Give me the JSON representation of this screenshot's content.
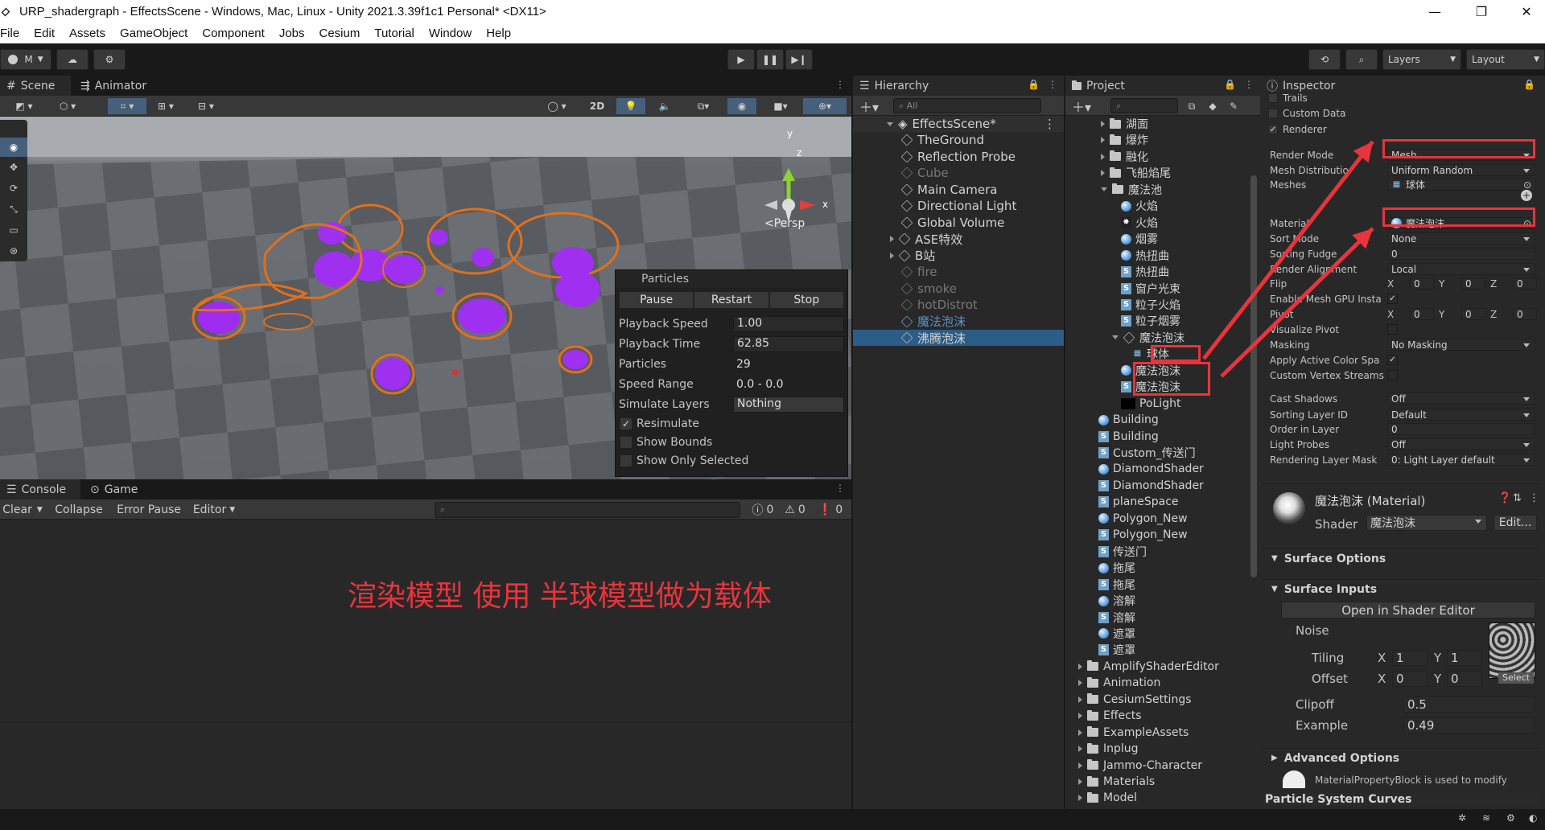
{
  "window": {
    "title": "URP_shadergraph - EffectsScene - Windows, Mac, Linux - Unity 2021.3.39f1c1 Personal* <DX11>"
  },
  "menu": [
    "File",
    "Edit",
    "Assets",
    "GameObject",
    "Component",
    "Jobs",
    "Cesium",
    "Tutorial",
    "Window",
    "Help"
  ],
  "toolbar": {
    "account": "M",
    "layers": "Layers",
    "layout": "Layout"
  },
  "scene": {
    "tabs": [
      "Scene",
      "Animator"
    ],
    "toolbar_2d": "2D",
    "persp_label": "<Persp",
    "gizmo_y": "y",
    "gizmo_x": "x",
    "gizmo_z": "z"
  },
  "particles": {
    "title": "Particles",
    "buttons": [
      "Pause",
      "Restart",
      "Stop"
    ],
    "rows": [
      {
        "label": "Playback Speed",
        "value": "1.00"
      },
      {
        "label": "Playback Time",
        "value": "62.85"
      },
      {
        "label": "Particles",
        "value": "29"
      },
      {
        "label": "Speed Range",
        "value": "0.0 - 0.0"
      },
      {
        "label": "Simulate Layers",
        "value": "Nothing"
      }
    ],
    "checks": [
      {
        "label": "Resimulate",
        "checked": true
      },
      {
        "label": "Show Bounds",
        "checked": false
      },
      {
        "label": "Show Only Selected",
        "checked": false
      }
    ]
  },
  "console": {
    "tabs": [
      "Console",
      "Game"
    ],
    "buttons": [
      "Clear",
      "Collapse",
      "Error Pause",
      "Editor"
    ],
    "counts": [
      "0",
      "0",
      "0"
    ],
    "annotation": "渲染模型 使用 半球模型做为载体"
  },
  "hierarchy": {
    "tab": "Hierarchy",
    "search_placeholder": "All",
    "scene": "EffectsScene*",
    "items": [
      {
        "label": "TheGround",
        "indent": 1,
        "dim": false,
        "arrow": ""
      },
      {
        "label": "Reflection Probe",
        "indent": 1,
        "dim": false,
        "arrow": ""
      },
      {
        "label": "Cube",
        "indent": 1,
        "dim": true,
        "arrow": ""
      },
      {
        "label": "Main Camera",
        "indent": 1,
        "dim": false,
        "arrow": ""
      },
      {
        "label": "Directional Light",
        "indent": 1,
        "dim": false,
        "arrow": ""
      },
      {
        "label": "Global Volume",
        "indent": 1,
        "dim": false,
        "arrow": ""
      },
      {
        "label": "ASE特效",
        "indent": 1,
        "dim": false,
        "arrow": "right"
      },
      {
        "label": "B站",
        "indent": 1,
        "dim": false,
        "arrow": "right"
      },
      {
        "label": "fire",
        "indent": 1,
        "dim": true,
        "arrow": ""
      },
      {
        "label": "smoke",
        "indent": 1,
        "dim": true,
        "arrow": ""
      },
      {
        "label": "hotDistrot",
        "indent": 1,
        "dim": true,
        "arrow": ""
      },
      {
        "label": "魔法泡沫",
        "indent": 1,
        "dim": true,
        "arrow": ""
      },
      {
        "label": "沸腾泡沫",
        "indent": 1,
        "dim": false,
        "arrow": "",
        "selected": true
      }
    ]
  },
  "project": {
    "tab": "Project",
    "items": [
      {
        "label": "湖面",
        "type": "folder",
        "indent": 2,
        "arrow": "right"
      },
      {
        "label": "爆炸",
        "type": "folder",
        "indent": 2,
        "arrow": "right"
      },
      {
        "label": "融化",
        "type": "folder",
        "indent": 2,
        "arrow": "right"
      },
      {
        "label": "飞船焰尾",
        "type": "folder",
        "indent": 2,
        "arrow": "right"
      },
      {
        "label": "魔法池",
        "type": "folder",
        "indent": 2,
        "arrow": "down"
      },
      {
        "label": "火焰",
        "type": "mat",
        "indent": 3,
        "arrow": ""
      },
      {
        "label": "火焰",
        "type": "tex",
        "indent": 3,
        "arrow": ""
      },
      {
        "label": "烟雾",
        "type": "mat",
        "indent": 3,
        "arrow": ""
      },
      {
        "label": "热扭曲",
        "type": "mat",
        "indent": 3,
        "arrow": ""
      },
      {
        "label": "热扭曲",
        "type": "shd",
        "indent": 3,
        "arrow": ""
      },
      {
        "label": "窗户光束",
        "type": "shd",
        "indent": 3,
        "arrow": ""
      },
      {
        "label": "粒子火焰",
        "type": "shd",
        "indent": 3,
        "arrow": ""
      },
      {
        "label": "粒子烟雾",
        "type": "shd",
        "indent": 3,
        "arrow": ""
      },
      {
        "label": "魔法泡沫",
        "type": "model",
        "indent": 3,
        "arrow": "down"
      },
      {
        "label": "球体",
        "type": "mesh",
        "indent": 4,
        "arrow": ""
      },
      {
        "label": "魔法泡沫",
        "type": "mat",
        "indent": 3,
        "arrow": ""
      },
      {
        "label": "魔法泡沫",
        "type": "shd",
        "indent": 3,
        "arrow": ""
      },
      {
        "label": "PoLight",
        "type": "black",
        "indent": 3,
        "arrow": ""
      },
      {
        "label": "Building",
        "type": "mat",
        "indent": 1,
        "arrow": ""
      },
      {
        "label": "Building",
        "type": "shd",
        "indent": 1,
        "arrow": ""
      },
      {
        "label": "Custom_传送门",
        "type": "shd",
        "indent": 1,
        "arrow": ""
      },
      {
        "label": "DiamondShader",
        "type": "mat",
        "indent": 1,
        "arrow": ""
      },
      {
        "label": "DiamondShader",
        "type": "shd",
        "indent": 1,
        "arrow": ""
      },
      {
        "label": "planeSpace",
        "type": "shd",
        "indent": 1,
        "arrow": ""
      },
      {
        "label": "Polygon_New",
        "type": "mat",
        "indent": 1,
        "arrow": ""
      },
      {
        "label": "Polygon_New",
        "type": "shd",
        "indent": 1,
        "arrow": ""
      },
      {
        "label": "传送门",
        "type": "shd",
        "indent": 1,
        "arrow": ""
      },
      {
        "label": "拖尾",
        "type": "mat",
        "indent": 1,
        "arrow": ""
      },
      {
        "label": "拖尾",
        "type": "shd",
        "indent": 1,
        "arrow": ""
      },
      {
        "label": "溶解",
        "type": "mat",
        "indent": 1,
        "arrow": ""
      },
      {
        "label": "溶解",
        "type": "shd",
        "indent": 1,
        "arrow": ""
      },
      {
        "label": "遮罩",
        "type": "mat",
        "indent": 1,
        "arrow": ""
      },
      {
        "label": "遮罩",
        "type": "shd",
        "indent": 1,
        "arrow": ""
      },
      {
        "label": "AmplifyShaderEditor",
        "type": "folder",
        "indent": 0,
        "arrow": "right"
      },
      {
        "label": "Animation",
        "type": "folder",
        "indent": 0,
        "arrow": "right"
      },
      {
        "label": "CesiumSettings",
        "type": "folder",
        "indent": 0,
        "arrow": "right"
      },
      {
        "label": "Effects",
        "type": "folder",
        "indent": 0,
        "arrow": "right"
      },
      {
        "label": "ExampleAssets",
        "type": "folder",
        "indent": 0,
        "arrow": "right"
      },
      {
        "label": "Inplug",
        "type": "folder",
        "indent": 0,
        "arrow": "right"
      },
      {
        "label": "Jammo-Character",
        "type": "folder",
        "indent": 0,
        "arrow": "right"
      },
      {
        "label": "Materials",
        "type": "folder",
        "indent": 0,
        "arrow": "right"
      },
      {
        "label": "Model",
        "type": "folder",
        "indent": 0,
        "arrow": "right"
      }
    ]
  },
  "inspector": {
    "tab": "Inspector",
    "top_checks": [
      {
        "label": "Trails",
        "checked": false
      },
      {
        "label": "Custom Data",
        "checked": false
      },
      {
        "label": "Renderer",
        "checked": true
      }
    ],
    "props": [
      {
        "label": "Render Mode",
        "value": "Mesh",
        "kind": "dropdown"
      },
      {
        "label": "Mesh Distributio",
        "value": "Uniform Random",
        "kind": "dropdown"
      },
      {
        "label": "Meshes",
        "value": "球体",
        "kind": "object"
      },
      {
        "label": "Material",
        "value": "魔法泡沫",
        "kind": "object"
      },
      {
        "label": "Sort Mode",
        "value": "None",
        "kind": "dropdown"
      },
      {
        "label": "Sorting Fudge",
        "value": "0",
        "kind": "field"
      },
      {
        "label": "Render Alignment",
        "value": "Local",
        "kind": "dropdown"
      },
      {
        "label": "Flip",
        "value": "X 0  Y 0  Z 0",
        "kind": "xyz"
      },
      {
        "label": "Enable Mesh GPU Insta",
        "value": "✓",
        "kind": "check"
      },
      {
        "label": "Pivot",
        "value": "X 0  Y 0  Z 0",
        "kind": "xyz"
      },
      {
        "label": "Visualize Pivot",
        "value": "",
        "kind": "check"
      },
      {
        "label": "Masking",
        "value": "No Masking",
        "kind": "dropdown"
      },
      {
        "label": "Apply Active Color Spa",
        "value": "✓",
        "kind": "check"
      },
      {
        "label": "Custom Vertex Streams",
        "value": "",
        "kind": "check"
      },
      {
        "label": "Cast Shadows",
        "value": "Off",
        "kind": "dropdown"
      },
      {
        "label": "Sorting Layer ID",
        "value": "Default",
        "kind": "dropdown"
      },
      {
        "label": "Order in Layer",
        "value": "0",
        "kind": "field"
      },
      {
        "label": "Light Probes",
        "value": "Off",
        "kind": "dropdown"
      },
      {
        "label": "Rendering Layer Mask",
        "value": "0: Light Layer default",
        "kind": "dropdown"
      }
    ],
    "material": {
      "name": "魔法泡沫 (Material)",
      "shader_label": "Shader",
      "shader": "魔法泡沫",
      "edit": "Edit..."
    },
    "surface_options": "Surface Options",
    "surface_inputs": "Surface Inputs",
    "open_shader": "Open in Shader Editor",
    "noise": "Noise",
    "tiling": {
      "label": "Tiling",
      "x": "1",
      "y": "1"
    },
    "offset": {
      "label": "Offset",
      "x": "0",
      "y": "0"
    },
    "select": "Select",
    "clipoff": {
      "label": "Clipoff",
      "value": "0.5"
    },
    "example": {
      "label": "Example",
      "value": "0.49"
    },
    "advanced": "Advanced Options",
    "info": "MaterialPropertyBlock is used to modify",
    "curves": "Particle System Curves"
  }
}
